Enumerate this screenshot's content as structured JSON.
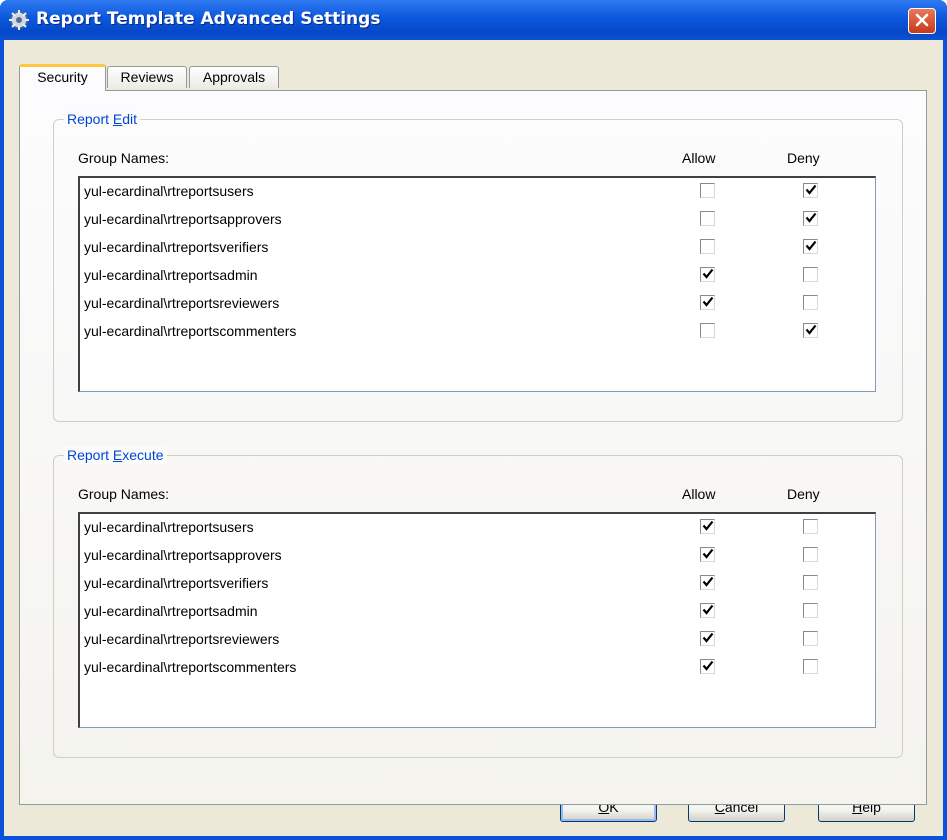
{
  "window": {
    "title": "Report Template Advanced Settings",
    "icon": "gear-icon",
    "close_icon": "close-icon"
  },
  "tabs": [
    {
      "label": "Security",
      "active": true
    },
    {
      "label": "Reviews",
      "active": false
    },
    {
      "label": "Approvals",
      "active": false
    }
  ],
  "report_edit": {
    "legend_prefix": "Report ",
    "legend_mnemonic": "E",
    "legend_suffix": "dit",
    "col_group": "Group Names:",
    "col_allow": "Allow",
    "col_deny": "Deny",
    "rows": [
      {
        "name": "yul-ecardinal\\rtreportsusers",
        "allow": false,
        "deny": true
      },
      {
        "name": "yul-ecardinal\\rtreportsapprovers",
        "allow": false,
        "deny": true
      },
      {
        "name": "yul-ecardinal\\rtreportsverifiers",
        "allow": false,
        "deny": true
      },
      {
        "name": "yul-ecardinal\\rtreportsadmin",
        "allow": true,
        "deny": false
      },
      {
        "name": "yul-ecardinal\\rtreportsreviewers",
        "allow": true,
        "deny": false
      },
      {
        "name": "yul-ecardinal\\rtreportscommenters",
        "allow": false,
        "deny": true
      }
    ]
  },
  "report_execute": {
    "legend_prefix": "Report ",
    "legend_mnemonic": "E",
    "legend_suffix": "xecute",
    "col_group": "Group Names:",
    "col_allow": "Allow",
    "col_deny": "Deny",
    "rows": [
      {
        "name": "yul-ecardinal\\rtreportsusers",
        "allow": true,
        "deny": false
      },
      {
        "name": "yul-ecardinal\\rtreportsapprovers",
        "allow": true,
        "deny": false
      },
      {
        "name": "yul-ecardinal\\rtreportsverifiers",
        "allow": true,
        "deny": false
      },
      {
        "name": "yul-ecardinal\\rtreportsadmin",
        "allow": true,
        "deny": false
      },
      {
        "name": "yul-ecardinal\\rtreportsreviewers",
        "allow": true,
        "deny": false
      },
      {
        "name": "yul-ecardinal\\rtreportscommenters",
        "allow": true,
        "deny": false
      }
    ]
  },
  "buttons": {
    "ok_mnemonic": "O",
    "ok_rest": "K",
    "cancel_mnemonic": "C",
    "cancel_rest": "ancel",
    "help_mnemonic": "H",
    "help_rest": "elp"
  },
  "colors": {
    "titlebar": "#0b58dd",
    "legend_text": "#0046d5",
    "dialog_bg": "#ece9d8",
    "close_button": "#c7381a"
  }
}
